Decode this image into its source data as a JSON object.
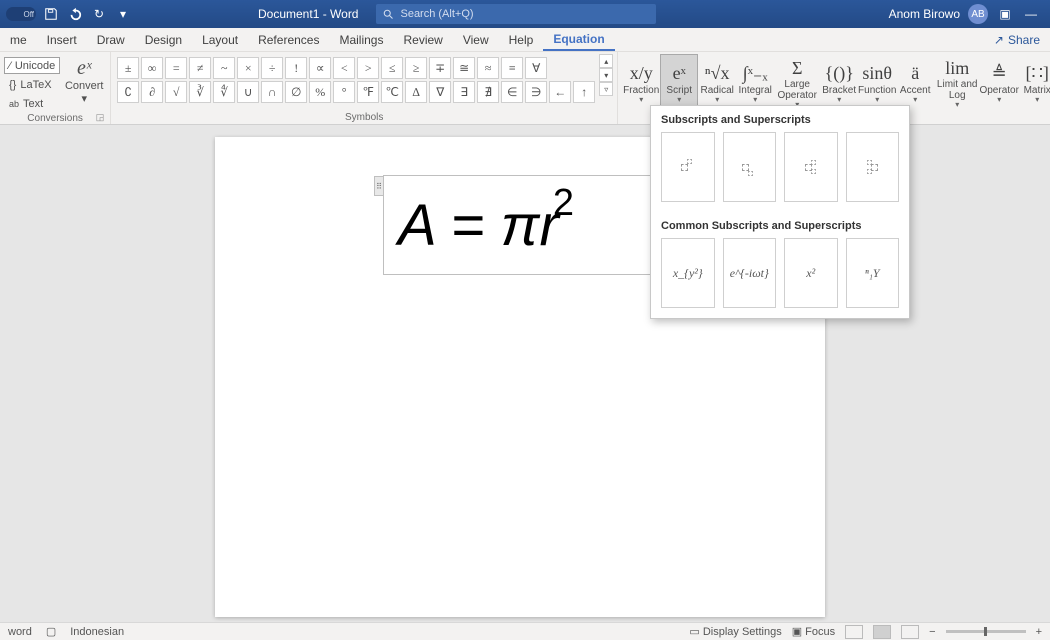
{
  "title_bar": {
    "autosave_label": "Off",
    "doc_title": "Document1 - Word",
    "search_placeholder": "Search (Alt+Q)",
    "user_name": "Anom Birowo",
    "user_initials": "AB"
  },
  "tabs": {
    "items": [
      "me",
      "Insert",
      "Draw",
      "Design",
      "Layout",
      "References",
      "Mailings",
      "Review",
      "View",
      "Help",
      "Equation"
    ],
    "active_index": 10,
    "share_label": "Share"
  },
  "tools_group": {
    "label": "Conversions",
    "unicode": "Unicode",
    "latex": "LaTeX",
    "text": "Text",
    "convert": "Convert",
    "convert_glyph": "eˣ"
  },
  "symbols_group": {
    "label": "Symbols",
    "row1": [
      "±",
      "∞",
      "=",
      "≠",
      "~",
      "×",
      "÷",
      "!",
      "∝",
      "<",
      ">",
      "≤",
      "≥",
      "∓",
      "≅",
      "≈",
      "≡",
      "∀"
    ],
    "row2": [
      "∁",
      "∂",
      "√",
      "∛",
      "∜",
      "∪",
      "∩",
      "∅",
      "%",
      "°",
      "℉",
      "℃",
      "∆",
      "∇",
      "∃",
      "∄",
      "∈",
      "∋",
      "←",
      "↑"
    ]
  },
  "structures": {
    "items": [
      {
        "label": "Fraction",
        "glyph": "x/y"
      },
      {
        "label": "Script",
        "glyph": "eˣ",
        "active": true
      },
      {
        "label": "Radical",
        "glyph": "ⁿ√x"
      },
      {
        "label": "Integral",
        "glyph": "∫ˣ₋ₓ"
      },
      {
        "label": "Large Operator",
        "glyph": "Σ",
        "wide": true
      },
      {
        "label": "Bracket",
        "glyph": "{()}"
      },
      {
        "label": "Function",
        "glyph": "sinθ"
      },
      {
        "label": "Accent",
        "glyph": "ä"
      },
      {
        "label": "Limit and Log",
        "glyph": "lim",
        "wide": true
      },
      {
        "label": "Operator",
        "glyph": "≜"
      },
      {
        "label": "Matrix",
        "glyph": "[∷]"
      }
    ]
  },
  "equation": {
    "display": "A = πr",
    "superscript": "2"
  },
  "dropdown": {
    "section1_title": "Subscripts and Superscripts",
    "section2_title": "Common Subscripts and Superscripts",
    "common": [
      "x_{y²}",
      "e^{-iωt}",
      "x²",
      "ⁿ₁Y"
    ]
  },
  "status_bar": {
    "left1": "word",
    "language": "Indonesian",
    "display_settings": "Display Settings",
    "focus": "Focus"
  }
}
